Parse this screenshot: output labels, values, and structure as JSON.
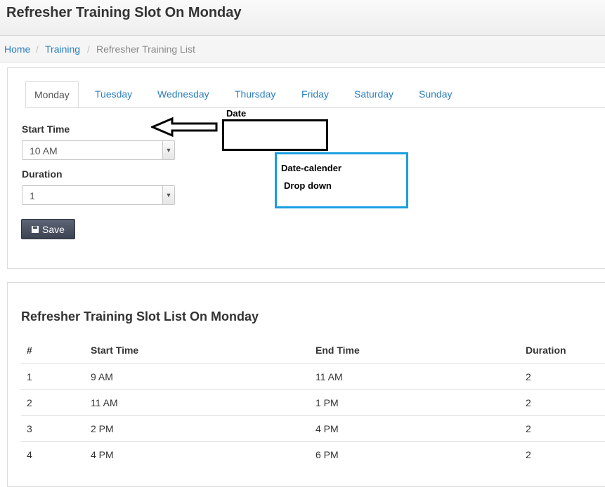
{
  "header": {
    "title": "Refresher Training Slot On Monday"
  },
  "breadcrumb": {
    "home": "Home",
    "training": "Training",
    "current": "Refresher Training List",
    "separator": "/"
  },
  "tabs": [
    "Monday",
    "Tuesday",
    "Wednesday",
    "Thursday",
    "Friday",
    "Saturday",
    "Sunday"
  ],
  "active_tab": "Monday",
  "form": {
    "start_time_label": "Start Time",
    "start_time_value": "10 AM",
    "duration_label": "Duration",
    "duration_value": "1",
    "save_label": "Save"
  },
  "annotations": {
    "date_label": "Date",
    "calendar_line1": "Date-calender",
    "calendar_line2": "Drop down"
  },
  "list": {
    "title": "Refresher Training Slot List On Monday",
    "columns": [
      "#",
      "Start Time",
      "End Time",
      "Duration"
    ],
    "rows": [
      [
        "1",
        "9 AM",
        "11 AM",
        "2"
      ],
      [
        "2",
        "11 AM",
        "1 PM",
        "2"
      ],
      [
        "3",
        "2 PM",
        "4 PM",
        "2"
      ],
      [
        "4",
        "4 PM",
        "6 PM",
        "2"
      ]
    ]
  },
  "colors": {
    "link": "#2a7fc0",
    "button": "#4a5160",
    "annotation_blue": "#1a9ee0"
  }
}
